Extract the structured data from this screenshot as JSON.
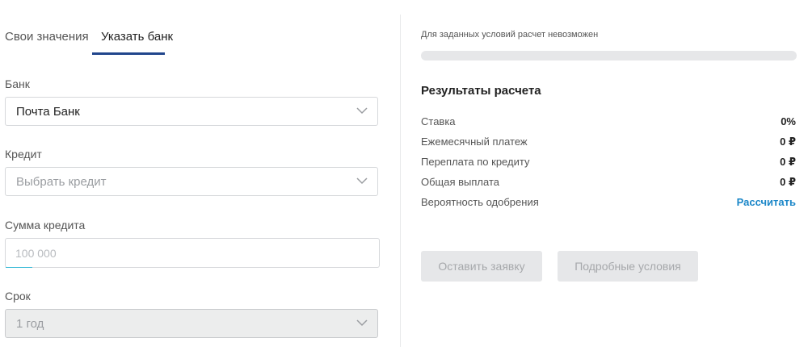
{
  "tabs": {
    "own_values": "Свои значения",
    "specify_bank": "Указать банк"
  },
  "form": {
    "bank": {
      "label": "Банк",
      "value": "Почта Банк"
    },
    "credit": {
      "label": "Кредит",
      "placeholder": "Выбрать кредит"
    },
    "amount": {
      "label": "Сумма кредита",
      "placeholder": "100 000"
    },
    "term": {
      "label": "Срок",
      "value": "1 год"
    }
  },
  "results": {
    "status": "Для заданных условий расчет невозможен",
    "progress": 0,
    "title": "Результаты расчета",
    "rows": [
      {
        "label": "Ставка",
        "value": "0%"
      },
      {
        "label": "Ежемесячный платеж",
        "value": "0 ₽"
      },
      {
        "label": "Переплата по кредиту",
        "value": "0 ₽"
      },
      {
        "label": "Общая выплата",
        "value": "0 ₽"
      },
      {
        "label": "Вероятность одобрения",
        "value": "Рассчитать"
      }
    ]
  },
  "buttons": {
    "apply": "Оставить заявку",
    "details": "Подробные условия"
  },
  "colors": {
    "accent": "#21468c",
    "link": "#1a86c8",
    "input_focus": "#37b9d6"
  },
  "icons": {
    "select_arrow": "chevron-down-icon"
  }
}
